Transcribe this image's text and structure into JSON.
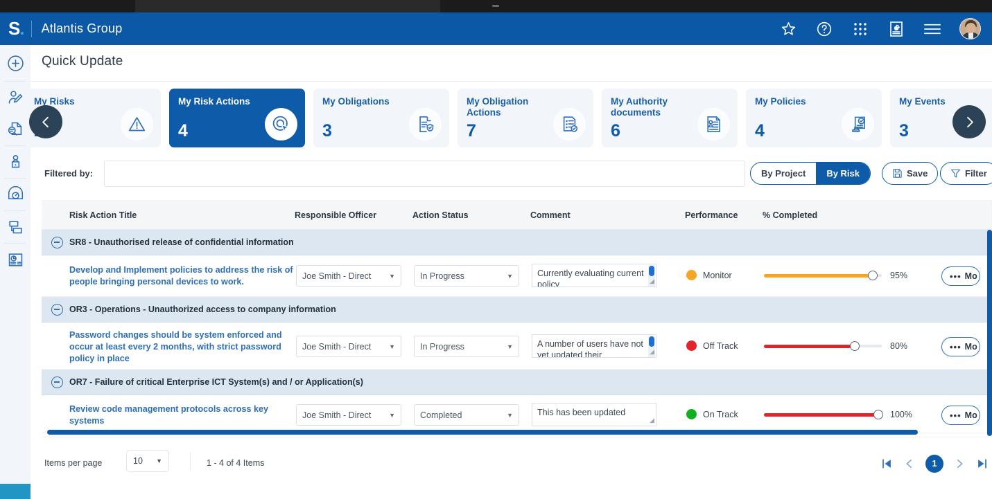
{
  "header": {
    "logo_text": "S",
    "logo_dot": ".",
    "org_title": "Atlantis Group",
    "icons": [
      "star-icon",
      "help-icon",
      "apps-grid-icon",
      "report-icon",
      "hamburger-menu-icon",
      "avatar"
    ]
  },
  "page_title": "Quick Update",
  "sidebar": {
    "items": [
      {
        "name": "add-icon"
      },
      {
        "name": "user-edit-icon"
      },
      {
        "name": "document-search-icon"
      },
      {
        "name": "user-desk-icon"
      },
      {
        "name": "gauge-icon"
      },
      {
        "name": "stacked-cards-icon"
      },
      {
        "name": "dashboard-report-icon"
      }
    ]
  },
  "cards": [
    {
      "title": "My Risks",
      "count": "2",
      "icon": "warning-triangle-icon",
      "active": false
    },
    {
      "title": "My Risk Actions",
      "count": "4",
      "icon": "click-target-icon",
      "active": true
    },
    {
      "title": "My Obligations",
      "count": "3",
      "icon": "document-shield-icon",
      "active": false
    },
    {
      "title": "My Obligation Actions",
      "count": "7",
      "icon": "checklist-icon",
      "active": false
    },
    {
      "title": "My Authority documents",
      "count": "6",
      "icon": "authority-doc-icon",
      "active": false
    },
    {
      "title": "My Policies",
      "count": "4",
      "icon": "policy-stamp-icon",
      "active": false
    },
    {
      "title": "My Events",
      "count": "3",
      "icon": "",
      "active": false
    }
  ],
  "carousel": {
    "prev": "chevron-left-icon",
    "next": "chevron-right-icon"
  },
  "filter_bar": {
    "label": "Filtered by:",
    "input_value": "",
    "input_placeholder": "",
    "segments": [
      {
        "label": "By Project",
        "selected": false
      },
      {
        "label": "By Risk",
        "selected": true
      }
    ],
    "save_label": "Save",
    "filter_label": "Filter"
  },
  "grid": {
    "columns": [
      "Risk Action Title",
      "Responsible Officer",
      "Action Status",
      "Comment",
      "Performance",
      "% Completed"
    ],
    "groups": [
      {
        "label": "SR8 - Unauthorised release of confidential information",
        "rows": [
          {
            "title": "Develop and Implement policies to address the risk of people bringing personal devices to work.",
            "officer": "Joe Smith - Direct",
            "status": "In Progress",
            "comment": "Currently evaluating current policy",
            "performance": "Monitor",
            "performance_color": "#f5a623",
            "percent": "95%",
            "percent_value": 95,
            "bar_color": "#f5a623",
            "more_label": "Mo"
          }
        ]
      },
      {
        "label": "OR3 - Operations - Unauthorized access to company information",
        "rows": [
          {
            "title": "Password changes should be system enforced and occur at least every 2 months, with strict password policy in place",
            "officer": "Joe Smith - Direct",
            "status": "In Progress",
            "comment": "A number of users have not yet updated their passwords",
            "performance": "Off Track",
            "performance_color": "#e2242e",
            "percent": "80%",
            "percent_value": 80,
            "bar_color": "#e2242e",
            "more_label": "Mo"
          }
        ]
      },
      {
        "label": "OR7 - Failure of critical Enterprise ICT System(s) and / or Application(s)",
        "rows": [
          {
            "title": "Review code management protocols across key systems",
            "officer": "Joe Smith - Direct",
            "status": "Completed",
            "comment": "This has been updated",
            "performance": "On Track",
            "performance_color": "#12b021",
            "percent": "100%",
            "percent_value": 100,
            "bar_color": "#e2242e",
            "more_label": "Mo"
          }
        ]
      }
    ]
  },
  "footer": {
    "items_per_page_label": "Items per page",
    "items_per_page_value": "10",
    "range_text": "1 - 4 of 4 Items",
    "current_page": "1"
  },
  "colors": {
    "brand_blue": "#0d5ba9",
    "header_blue": "#0a58a6",
    "group_row": "#dde7f1",
    "amber": "#f5a623",
    "red": "#e2242e",
    "green": "#12b021"
  }
}
